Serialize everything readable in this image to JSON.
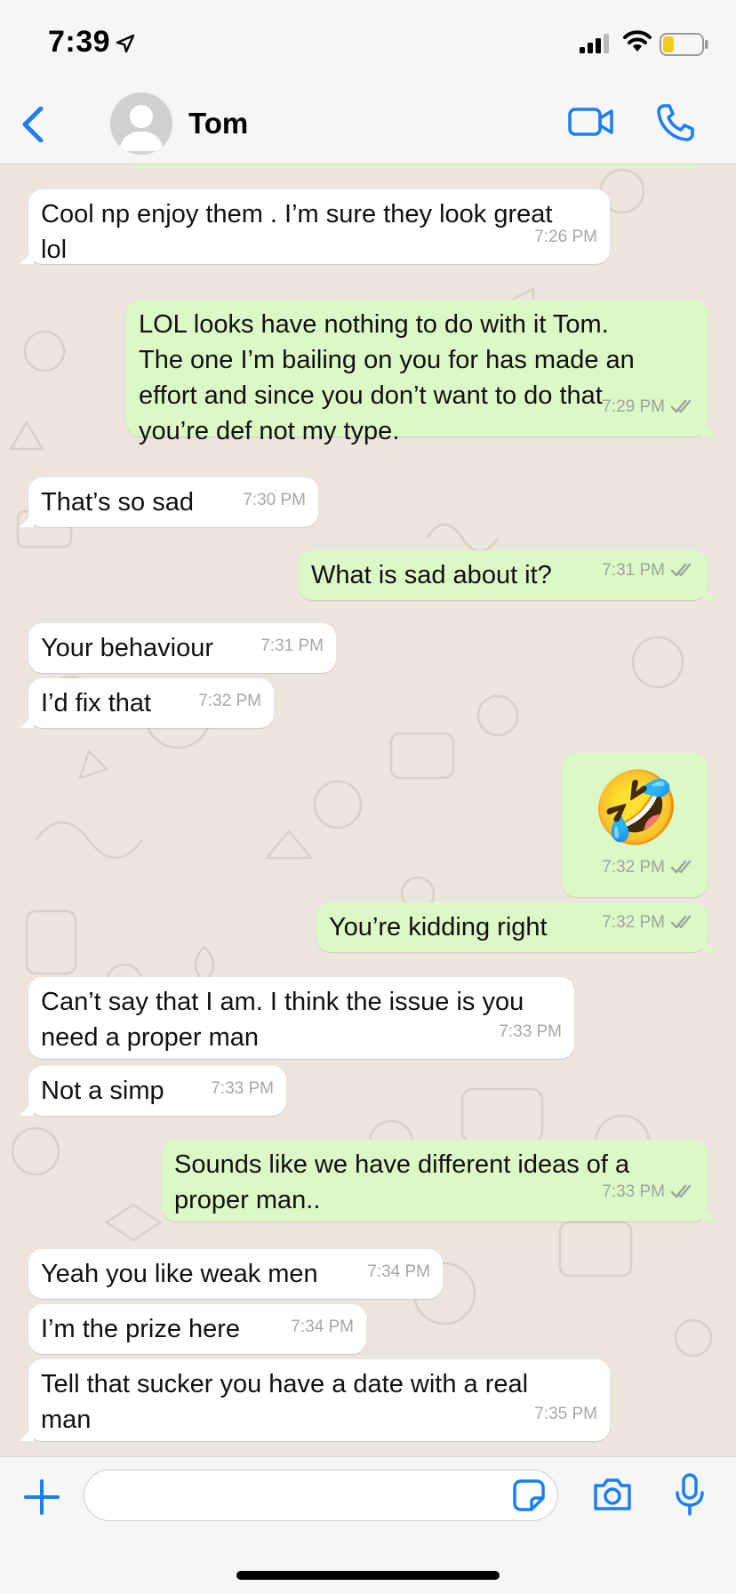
{
  "status_bar": {
    "time": "7:39"
  },
  "header": {
    "contact_name": "Tom"
  },
  "messages": [
    {
      "dir": "in",
      "lines": [
        "Cool np enjoy them . I’m sure they look great",
        "lol"
      ],
      "time": "7:26 PM"
    },
    {
      "dir": "out",
      "lines": [
        "LOL looks have nothing to do with it Tom.",
        "The one I’m bailing on you for has made an",
        "effort and since you don’t want to do that",
        "you’re def not my type."
      ],
      "time": "7:29 PM"
    },
    {
      "dir": "in",
      "lines": [
        "That’s so sad"
      ],
      "time": "7:30 PM"
    },
    {
      "dir": "out",
      "lines": [
        "What is sad about it?"
      ],
      "time": "7:31 PM"
    },
    {
      "dir": "in",
      "lines": [
        "Your behaviour"
      ],
      "time": "7:31 PM"
    },
    {
      "dir": "in",
      "lines": [
        "I’d fix that"
      ],
      "time": "7:32 PM"
    },
    {
      "dir": "out",
      "emoji": "🤣",
      "time": "7:32 PM"
    },
    {
      "dir": "out",
      "lines": [
        "You’re kidding right"
      ],
      "time": "7:32 PM"
    },
    {
      "dir": "in",
      "lines": [
        "Can’t say that I am. I think the issue is you",
        "need a proper man"
      ],
      "time": "7:33 PM"
    },
    {
      "dir": "in",
      "lines": [
        "Not a simp"
      ],
      "time": "7:33 PM"
    },
    {
      "dir": "out",
      "lines": [
        "Sounds like we have different ideas of a",
        "proper man.."
      ],
      "time": "7:33 PM"
    },
    {
      "dir": "in",
      "lines": [
        "Yeah you like weak men"
      ],
      "time": "7:34 PM"
    },
    {
      "dir": "in",
      "lines": [
        "I’m the prize here"
      ],
      "time": "7:34 PM"
    },
    {
      "dir": "in",
      "lines": [
        "Tell that sucker you have a date with a real",
        "man"
      ],
      "time": "7:35 PM"
    }
  ],
  "colors": {
    "accent": "#1a7ef6",
    "incoming": "#ffffff",
    "outgoing": "#dcf8c6",
    "chat_bg": "#ece5dd"
  },
  "icons": [
    "back-chevron-icon",
    "video-call-icon",
    "phone-icon",
    "plus-icon",
    "sticker-icon",
    "camera-icon",
    "microphone-icon"
  ]
}
